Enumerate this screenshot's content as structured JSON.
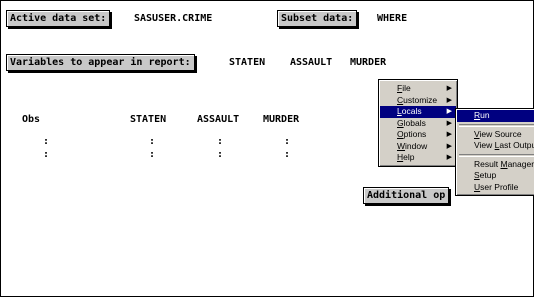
{
  "header": {
    "active_label": "Active data set:",
    "active_value": "SASUSER.CRIME",
    "subset_label": "Subset data:",
    "subset_value": "WHERE",
    "vars_label": "Variables to appear in report:",
    "vars": [
      "STATEN",
      "ASSAULT",
      "MURDER"
    ]
  },
  "report": {
    "columns": [
      "Obs",
      "STATEN",
      "ASSAULT",
      "MURDER"
    ],
    "dots": ":"
  },
  "menu": {
    "items": [
      {
        "first": "F",
        "rest": "ile",
        "submenu": true
      },
      {
        "first": "C",
        "rest": "ustomize",
        "submenu": true
      },
      {
        "first": "L",
        "rest": "ocals",
        "submenu": true,
        "highlighted": true
      },
      {
        "first": "G",
        "rest": "lobals",
        "submenu": true
      },
      {
        "first": "O",
        "rest": "ptions",
        "submenu": true
      },
      {
        "first": "W",
        "rest": "indow",
        "submenu": true
      },
      {
        "first": "H",
        "rest": "elp",
        "submenu": true
      }
    ],
    "arrow": "▶"
  },
  "submenu": {
    "run": {
      "first": "R",
      "rest": "un"
    },
    "view_source": {
      "first": "V",
      "rest": "iew Source"
    },
    "view_last_output": {
      "pre": "View ",
      "first": "L",
      "rest": "ast Output"
    },
    "result_manager": {
      "pre": "Result ",
      "first": "M",
      "rest": "anager"
    },
    "setup": {
      "first": "S",
      "rest": "etup"
    },
    "user_profile": {
      "first": "U",
      "rest": "ser Profile"
    }
  },
  "additional": {
    "label": "Additional op"
  }
}
